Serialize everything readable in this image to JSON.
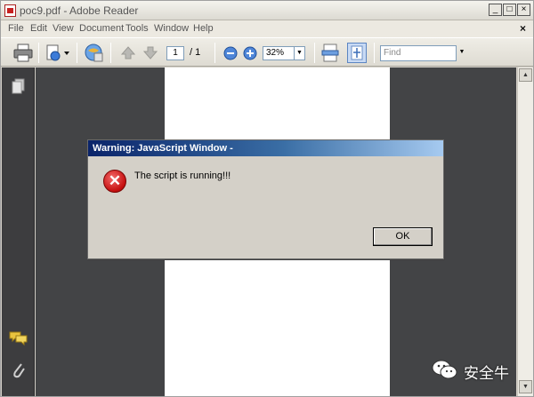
{
  "window": {
    "title": "poc9.pdf - Adobe Reader",
    "controls": [
      "_",
      "□",
      "×"
    ]
  },
  "menu": {
    "items": [
      "File",
      "Edit",
      "View",
      "Document",
      "Tools",
      "Window",
      "Help"
    ],
    "close_glyph": "×"
  },
  "toolbar": {
    "page_current": "1",
    "page_total": "/ 1",
    "zoom_value": "32%",
    "find_placeholder": "Find"
  },
  "dialog": {
    "title": "Warning: JavaScript Window -",
    "message": "The script is running!!!",
    "ok_label": "OK",
    "icon_glyph": "✕"
  },
  "watermark": {
    "text": "安全牛"
  },
  "colors": {
    "dialog_title_start": "#0a246a",
    "dialog_title_end": "#a6caf0",
    "document_background": "#434446",
    "nav_panel": "#3d3d3f",
    "error_icon": "#c40e0e"
  },
  "icons": {
    "toolbar": [
      "print-icon",
      "attach-icon",
      "collaborate-icon",
      "previous-page-icon",
      "next-page-icon",
      "zoom-out-icon",
      "zoom-in-icon",
      "fit-width-icon",
      "fit-page-icon"
    ],
    "nav": [
      "pages-icon",
      "comments-icon",
      "attachments-icon"
    ]
  }
}
